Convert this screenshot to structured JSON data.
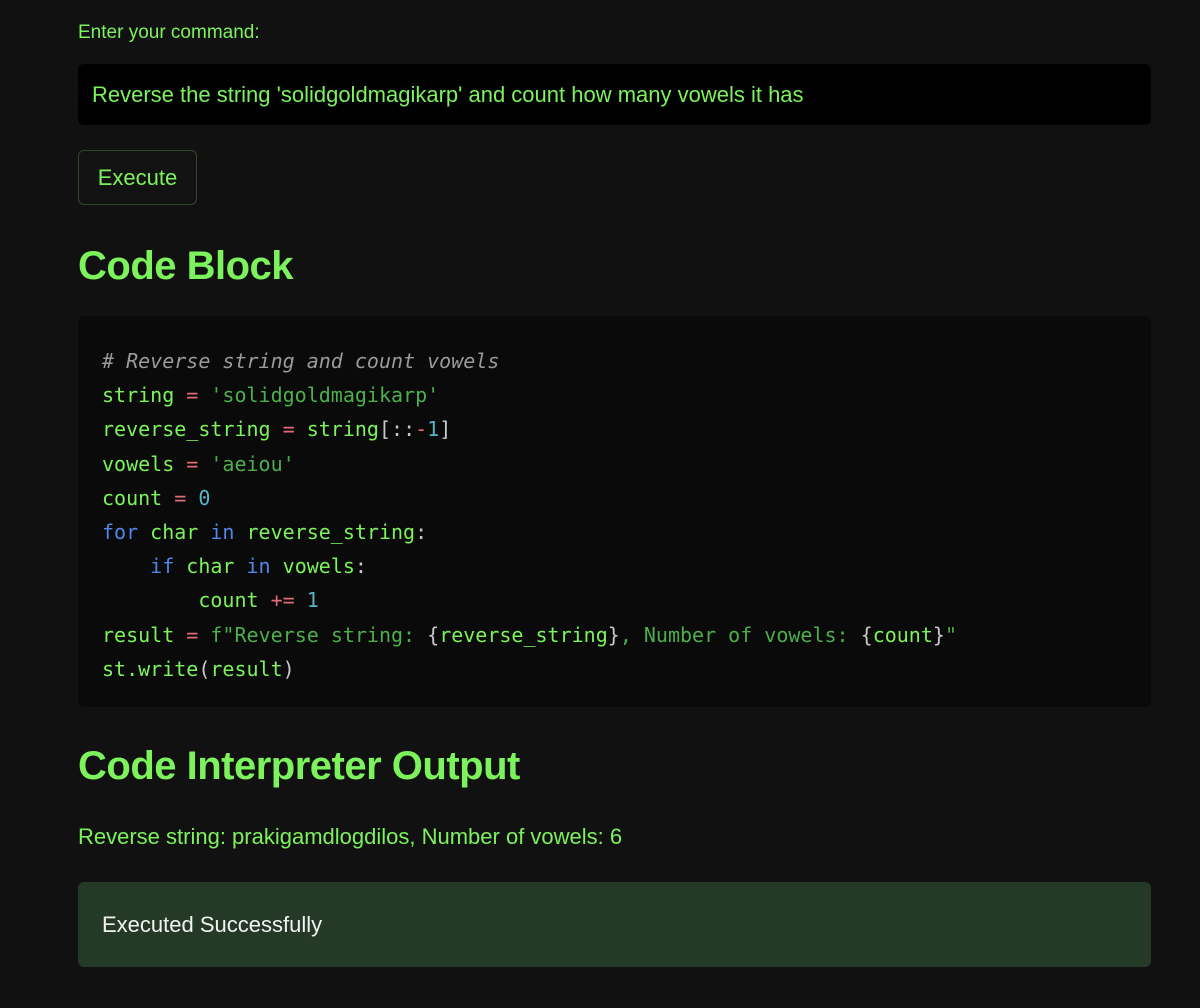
{
  "input": {
    "label": "Enter your command:",
    "value": "Reverse the string 'solidgoldmagikarp' and count how many vowels it has"
  },
  "execute_button": {
    "label": "Execute"
  },
  "code_section": {
    "title": "Code Block",
    "lines": [
      "# Reverse string and count vowels",
      "string = 'solidgoldmagikarp'",
      "reverse_string = string[::-1]",
      "vowels = 'aeiou'",
      "count = 0",
      "for char in reverse_string:",
      "    if char in vowels:",
      "        count += 1",
      "result = f\"Reverse string: {reverse_string}, Number of vowels: {count}\"",
      "st.write(result)"
    ]
  },
  "output_section": {
    "title": "Code Interpreter Output",
    "result_text": "Reverse string: prakigamdlogdilos, Number of vowels: 6",
    "status_text": "Executed Successfully"
  },
  "colors": {
    "background": "#111111",
    "accent_green": "#7cf25c",
    "success_bg": "#243a26",
    "input_bg": "#000000",
    "code_bg": "#0a0a0a"
  }
}
